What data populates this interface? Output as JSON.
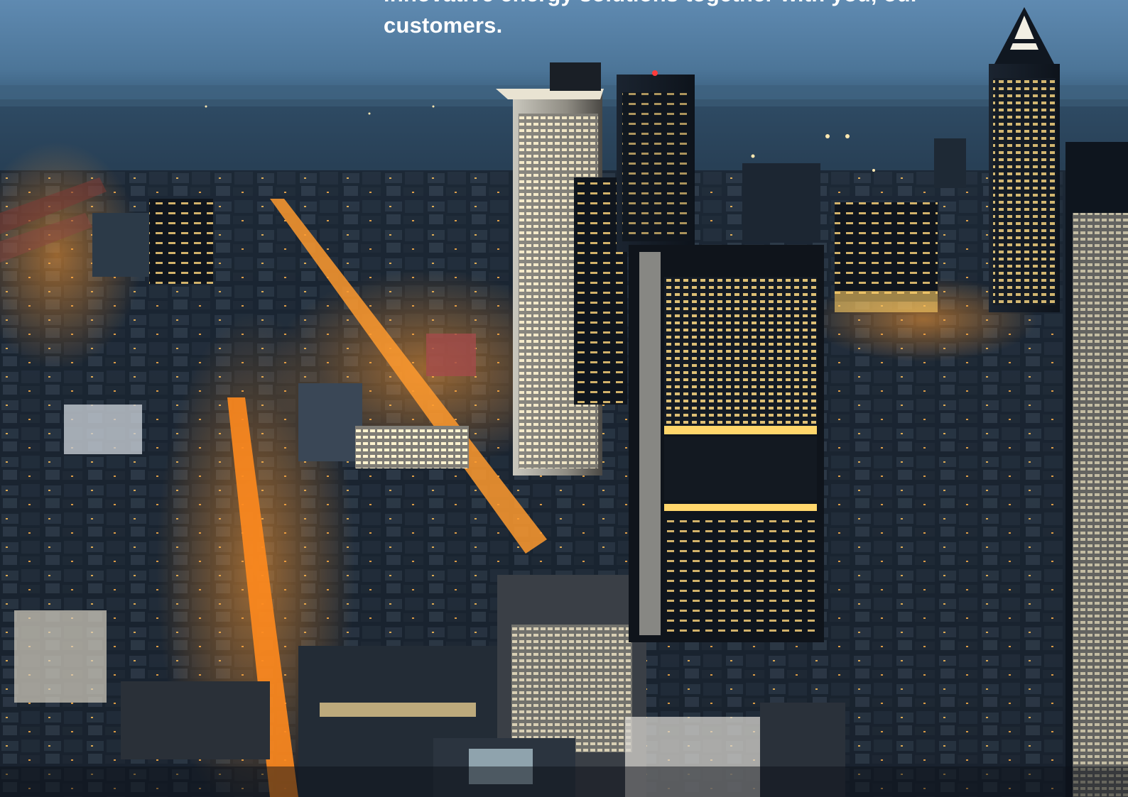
{
  "photo": {
    "subject": "night-city-skyline-photo"
  },
  "headline": {
    "text": "innovative energy solutions together with you, our customers."
  },
  "colors": {
    "sky_top": "#5b86ad",
    "sky_horizon": "#3d6282",
    "city_dark": "#111a24",
    "street_glow": "#ff8a1e",
    "window_light": "#ffe49a",
    "text": "#ffffff"
  }
}
